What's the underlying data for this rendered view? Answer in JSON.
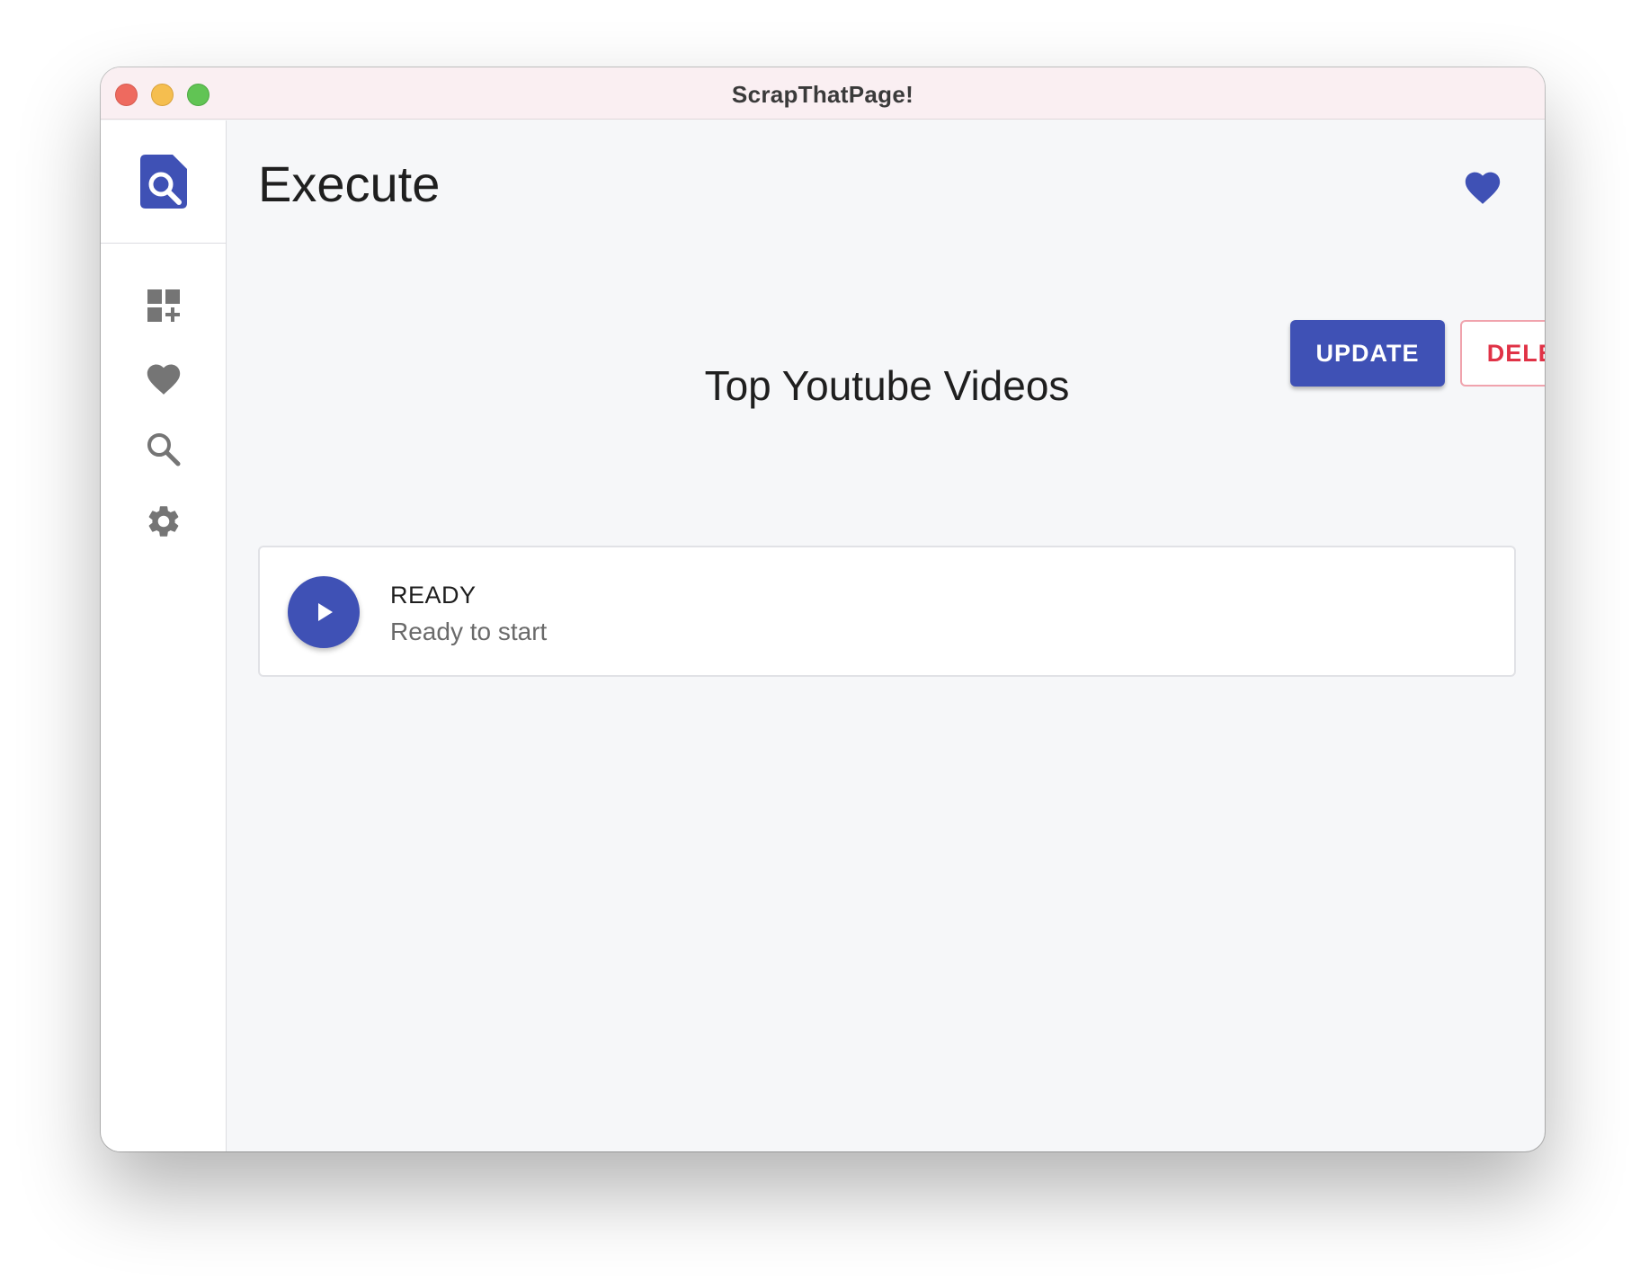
{
  "window": {
    "title": "ScrapThatPage!"
  },
  "sidebar": {
    "logo_icon": "search-document-icon",
    "items": [
      {
        "name": "dashboard-add",
        "icon": "dashboard-add-icon"
      },
      {
        "name": "favorites",
        "icon": "heart-icon"
      },
      {
        "name": "search",
        "icon": "search-icon"
      },
      {
        "name": "settings",
        "icon": "gear-icon"
      }
    ]
  },
  "header": {
    "title": "Execute",
    "favorite_icon": "heart-icon"
  },
  "actions": {
    "update_label": "UPDATE",
    "delete_label": "DELETE"
  },
  "scraper": {
    "name": "Top Youtube Videos",
    "status": "READY",
    "status_description": "Ready to start",
    "play_icon": "play-icon"
  },
  "colors": {
    "accent": "#3f51b5",
    "danger": "#e03246",
    "icon_gray": "#757575"
  }
}
